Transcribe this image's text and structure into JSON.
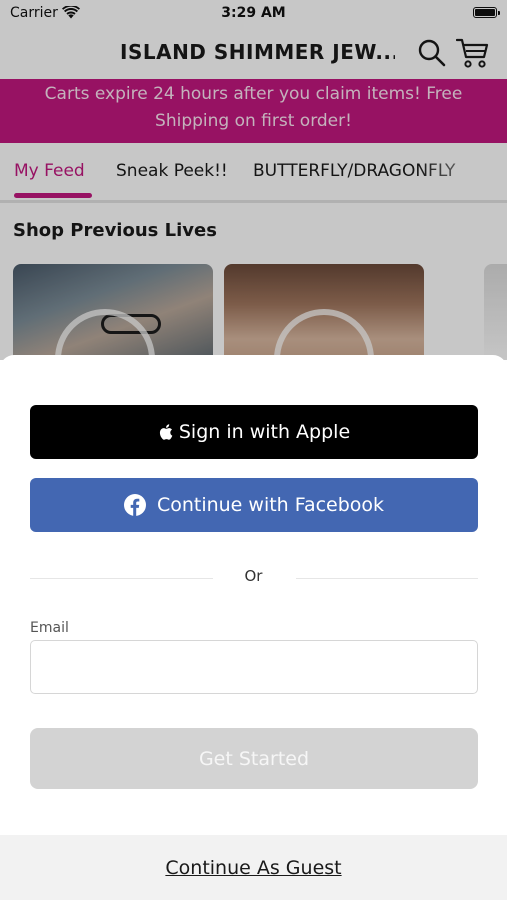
{
  "status_bar": {
    "carrier": "Carrier",
    "time": "3:29 AM",
    "icons": [
      "wifi-icon",
      "battery-icon"
    ]
  },
  "nav": {
    "title": "ISLAND SHIMMER JEW...",
    "icons": [
      "search-icon",
      "cart-icon"
    ]
  },
  "banner": {
    "line1": "Carts expire 24 hours after you claim items! Free",
    "line2": "Shipping on first order!",
    "color": "#c2187f"
  },
  "tabs": [
    {
      "label": "My Feed",
      "active": true
    },
    {
      "label": "Sneak Peek!!",
      "active": false
    },
    {
      "label": "BUTTERFLY/DRAGONFLY",
      "active": false
    }
  ],
  "feed": {
    "section_title": "Shop Previous Lives"
  },
  "sheet": {
    "apple_label": "Sign in with Apple",
    "facebook_label": "Continue with Facebook",
    "or_text": "Or",
    "email_label": "Email",
    "email_value": "",
    "get_started_label": "Get Started",
    "guest_label": "Continue As Guest",
    "colors": {
      "apple_bg": "#000000",
      "facebook_bg": "#4367b2",
      "get_started_bg": "#d3d3d3"
    }
  }
}
